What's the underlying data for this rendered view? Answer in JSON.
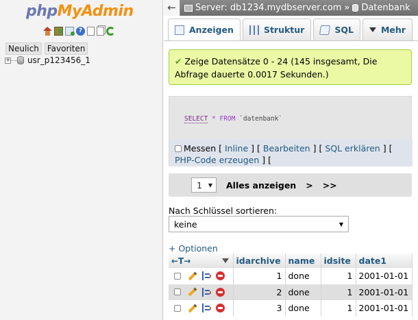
{
  "nav": {
    "logo_php": "php",
    "logo_myadmin": "MyAdmin",
    "icons": [
      "home-icon",
      "logout-icon",
      "query-window-icon",
      "help-icon",
      "docs-icon",
      "settings-icon",
      "reload-icon"
    ],
    "buttons": {
      "new": "Neulich",
      "favorites": "Favoriten"
    },
    "tree": [
      {
        "label": "usr_p123456_1"
      }
    ]
  },
  "topbar": {
    "server": "Server: db1234.mydbserver.com",
    "separator": "»",
    "database": "Datenbank"
  },
  "tabs": [
    {
      "label": "Anzeigen",
      "icon": "browse-icon"
    },
    {
      "label": "Struktur",
      "icon": "structure-icon"
    },
    {
      "label": "SQL",
      "icon": "sql-icon"
    },
    {
      "label": "Mehr",
      "icon": "chevron-down-icon"
    }
  ],
  "message": {
    "text": "Zeige Datensätze 0 - 24 (145 insgesamt, Die Abfrage dauerte 0.0017 Sekunden.)",
    "accent": "#ebf8a4"
  },
  "sql": {
    "keyword": "SELECT",
    "star": "*",
    "from": "FROM",
    "table": "`datenbank`"
  },
  "sql_links": {
    "profiling": "Messen",
    "inline": "Inline",
    "edit": "Bearbeiten",
    "explain": "SQL erklären",
    "php_code": "PHP-Code erzeugen",
    "bracket_open": "[",
    "bracket_close": "]"
  },
  "pagination": {
    "page": "1",
    "show_all": "Alles anzeigen",
    "next": ">",
    "last": ">>"
  },
  "sort": {
    "label": "Nach Schlüssel sortieren:",
    "value": "keine"
  },
  "options_link": "+ Optionen",
  "table": {
    "arrows": "←T→",
    "columns": [
      "idarchive",
      "name",
      "idsite",
      "date1"
    ],
    "rows": [
      {
        "idarchive": "1",
        "name": "done",
        "idsite": "1",
        "date1": "2001-01-01"
      },
      {
        "idarchive": "2",
        "name": "done",
        "idsite": "1",
        "date1": "2001-01-01"
      },
      {
        "idarchive": "3",
        "name": "done",
        "idsite": "1",
        "date1": "2001-01-01"
      }
    ]
  }
}
